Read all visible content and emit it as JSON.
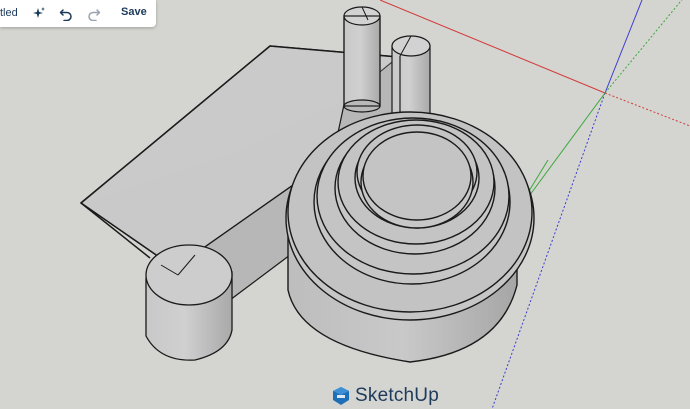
{
  "toolbar": {
    "title_fragment": "tled",
    "save_label": "Save"
  },
  "branding": {
    "logo_text": "SketchUp"
  },
  "colors": {
    "background": "#d4d5d0",
    "axis_red": "#d23c3c",
    "axis_green": "#3ca83c",
    "axis_blue": "#3c3cd2",
    "brand": "#1e3a5c",
    "model_face": "#c3c3c3",
    "model_edge": "#1a1a1a"
  },
  "icons": {
    "sparkle": "sparkle-icon",
    "undo": "undo-icon",
    "redo": "redo-icon",
    "logo": "sketchup-logo-icon"
  }
}
